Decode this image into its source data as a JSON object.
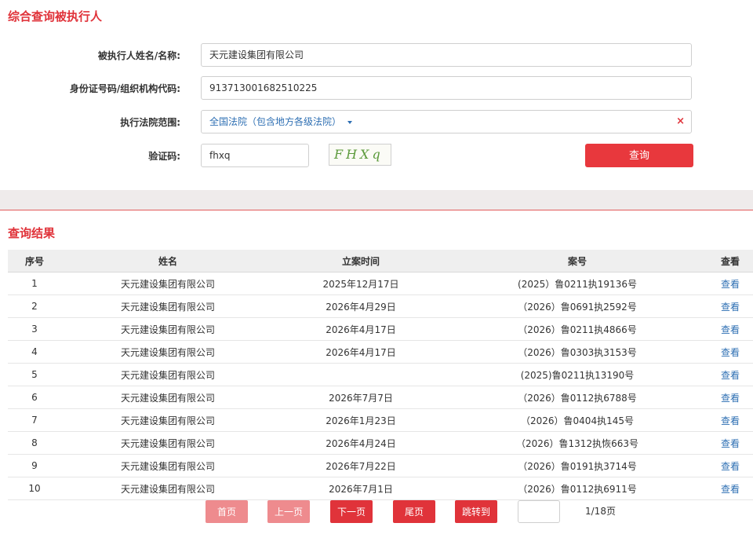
{
  "search": {
    "title": "综合查询被执行人",
    "name_label": "被执行人姓名/名称:",
    "name_value": "天元建设集团有限公司",
    "id_label": "身份证号码/组织机构代码:",
    "id_value": "913713001682510225",
    "court_label": "执行法院范围:",
    "court_value": "全国法院（包含地方各级法院）",
    "clear_glyph": "×",
    "captcha_label": "验证码:",
    "captcha_value": "fhxq",
    "captcha_image_text": "FHXq",
    "query_label": "查询"
  },
  "results": {
    "title": "查询结果",
    "headers": [
      "序号",
      "姓名",
      "立案时间",
      "案号",
      "查看"
    ],
    "rows": [
      {
        "no": "1",
        "name": "天元建设集团有限公司",
        "date": "2025年12月17日",
        "case": "(2025）鲁0211执19136号",
        "view": "查看"
      },
      {
        "no": "2",
        "name": "天元建设集团有限公司",
        "date": "2026年4月29日",
        "case": "（2026）鲁0691执2592号",
        "view": "查看"
      },
      {
        "no": "3",
        "name": "天元建设集团有限公司",
        "date": "2026年4月17日",
        "case": "（2026）鲁0211执4866号",
        "view": "查看"
      },
      {
        "no": "4",
        "name": "天元建设集团有限公司",
        "date": "2026年4月17日",
        "case": "（2026）鲁0303执3153号",
        "view": "查看"
      },
      {
        "no": "5",
        "name": "天元建设集团有限公司",
        "date": "",
        "case": "(2025)鲁0211执13190号",
        "view": "查看"
      },
      {
        "no": "6",
        "name": "天元建设集团有限公司",
        "date": "2026年7月7日",
        "case": "（2026）鲁0112执6788号",
        "view": "查看"
      },
      {
        "no": "7",
        "name": "天元建设集团有限公司",
        "date": "2026年1月23日",
        "case": "（2026）鲁0404执145号",
        "view": "查看"
      },
      {
        "no": "8",
        "name": "天元建设集团有限公司",
        "date": "2026年4月24日",
        "case": "（2026）鲁1312执恢663号",
        "view": "查看"
      },
      {
        "no": "9",
        "name": "天元建设集团有限公司",
        "date": "2026年7月22日",
        "case": "（2026）鲁0191执3714号",
        "view": "查看"
      },
      {
        "no": "10",
        "name": "天元建设集团有限公司",
        "date": "2026年7月1日",
        "case": "（2026）鲁0112执6911号",
        "view": "查看"
      }
    ]
  },
  "pagination": {
    "first": "首页",
    "prev": "上一页",
    "next": "下一页",
    "last": "尾页",
    "jump": "跳转到",
    "jump_value": "",
    "page_count": "1/18页"
  },
  "colors": {
    "accent": "#e0333a",
    "link": "#2e6fb3",
    "disabled_button": "#ee8b8e"
  }
}
